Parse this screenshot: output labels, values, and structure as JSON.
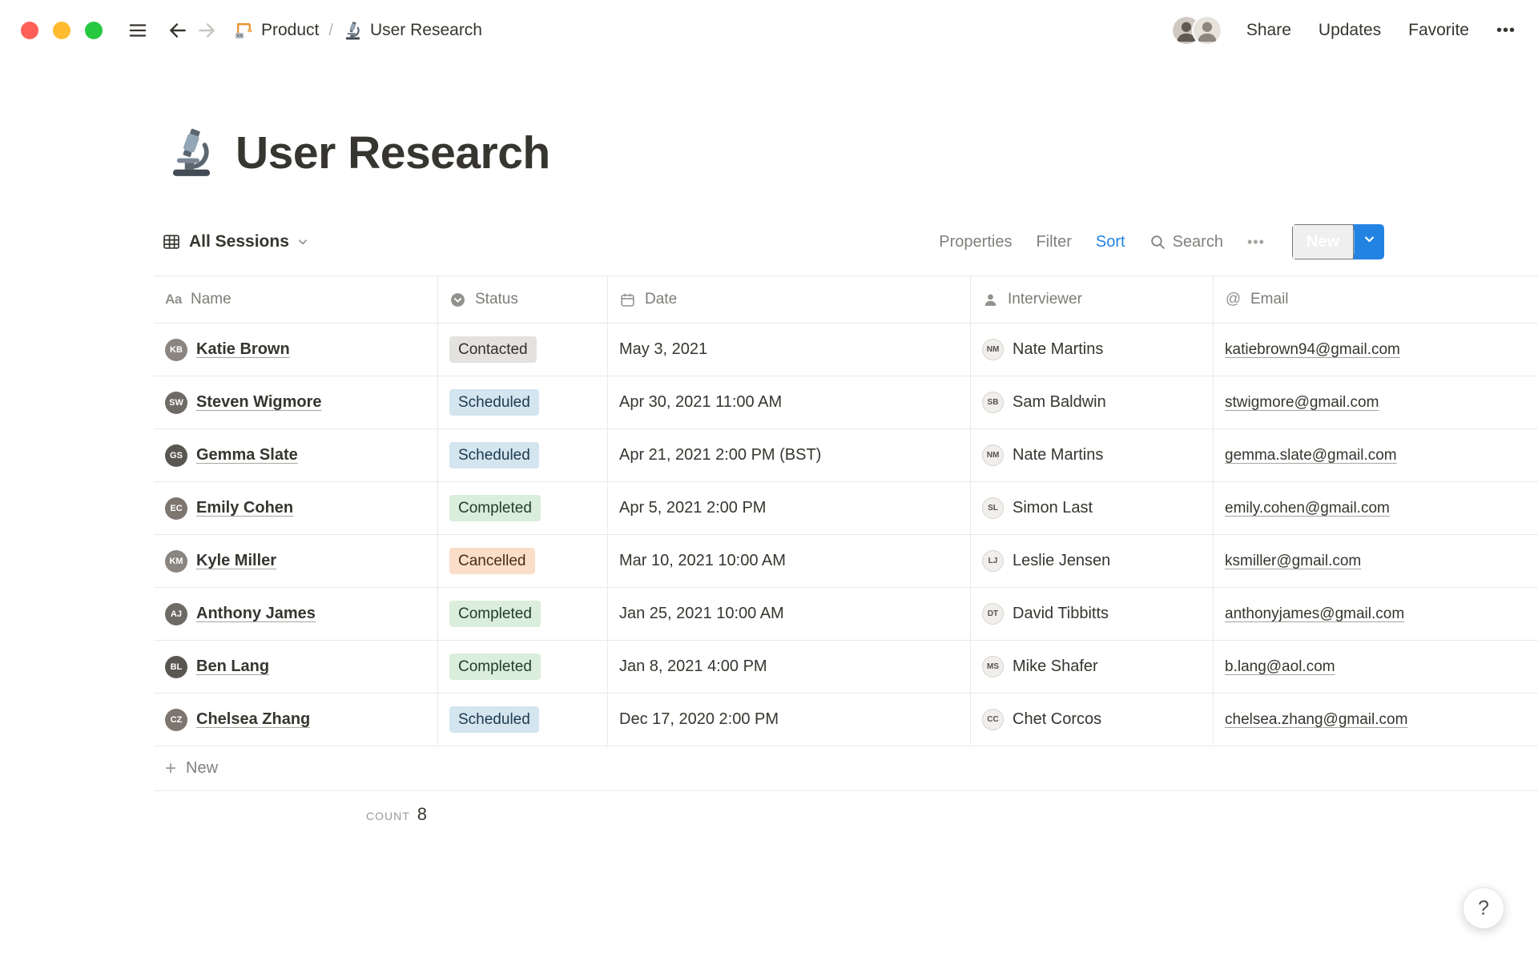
{
  "colors": {
    "accent": "#2383e2",
    "traffic": [
      "#ff5f57",
      "#febc2e",
      "#28c840"
    ],
    "border": "#e9e9e7",
    "badge": {
      "gray": {
        "bg": "#e3e2e0",
        "text": "#32302c"
      },
      "blue": {
        "bg": "#d3e5ef",
        "text": "#1d3a4e"
      },
      "green": {
        "bg": "#dbeddb",
        "text": "#1f3d2b"
      },
      "orange": {
        "bg": "#fadec9",
        "text": "#4e2c10"
      }
    },
    "avatar_tones": [
      "#8a8580",
      "#6e6a66",
      "#5a5651",
      "#7c766f"
    ]
  },
  "topbar": {
    "breadcrumb": [
      {
        "label": "Product",
        "icon": "construction-icon"
      },
      {
        "label": "User Research",
        "icon": "microscope-icon"
      }
    ],
    "separator": "/",
    "share": "Share",
    "updates": "Updates",
    "favorite": "Favorite",
    "more": "•••"
  },
  "page": {
    "icon": "microscope-icon",
    "title": "User Research"
  },
  "toolbar": {
    "view_name": "All Sessions",
    "properties": "Properties",
    "filter": "Filter",
    "sort": "Sort",
    "search": "Search",
    "more": "•••",
    "new": "New"
  },
  "table": {
    "columns": [
      {
        "label": "Name",
        "icon": "text-icon"
      },
      {
        "label": "Status",
        "icon": "select-icon"
      },
      {
        "label": "Date",
        "icon": "calendar-icon"
      },
      {
        "label": "Interviewer",
        "icon": "person-icon"
      },
      {
        "label": "Email",
        "icon": "at-icon"
      }
    ],
    "rows": [
      {
        "name": "Katie Brown",
        "status": "Contacted",
        "status_color": "gray",
        "date": "May 3, 2021",
        "interviewer": "Nate Martins",
        "email": "katiebrown94@gmail.com"
      },
      {
        "name": "Steven Wigmore",
        "status": "Scheduled",
        "status_color": "blue",
        "date": "Apr 30, 2021 11:00 AM",
        "interviewer": "Sam Baldwin",
        "email": "stwigmore@gmail.com"
      },
      {
        "name": "Gemma Slate",
        "status": "Scheduled",
        "status_color": "blue",
        "date": "Apr 21, 2021 2:00 PM (BST)",
        "interviewer": "Nate Martins",
        "email": "gemma.slate@gmail.com"
      },
      {
        "name": "Emily Cohen",
        "status": "Completed",
        "status_color": "green",
        "date": "Apr 5, 2021 2:00 PM",
        "interviewer": "Simon Last",
        "email": "emily.cohen@gmail.com"
      },
      {
        "name": "Kyle Miller",
        "status": "Cancelled",
        "status_color": "orange",
        "date": "Mar 10, 2021 10:00 AM",
        "interviewer": "Leslie Jensen",
        "email": "ksmiller@gmail.com"
      },
      {
        "name": "Anthony James",
        "status": "Completed",
        "status_color": "green",
        "date": "Jan 25, 2021 10:00 AM",
        "interviewer": "David Tibbitts",
        "email": "anthonyjames@gmail.com"
      },
      {
        "name": "Ben Lang",
        "status": "Completed",
        "status_color": "green",
        "date": "Jan 8, 2021 4:00 PM",
        "interviewer": "Mike Shafer",
        "email": "b.lang@aol.com"
      },
      {
        "name": "Chelsea Zhang",
        "status": "Scheduled",
        "status_color": "blue",
        "date": "Dec 17, 2020 2:00 PM",
        "interviewer": "Chet Corcos",
        "email": "chelsea.zhang@gmail.com"
      }
    ],
    "new_row_label": "New",
    "new_row_plus": "+",
    "footer": {
      "count_label": "COUNT",
      "count_value": "8"
    }
  },
  "help_label": "?"
}
